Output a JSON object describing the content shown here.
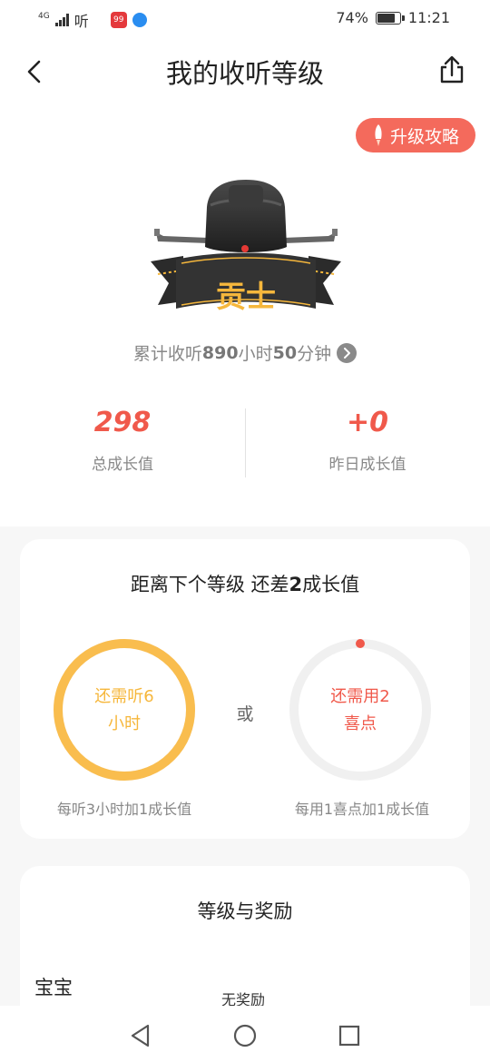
{
  "status_bar": {
    "network": "4G",
    "carrier_text": "听",
    "app_badge": "99",
    "battery_percent": "74%",
    "battery_level": 0.74,
    "time": "11:21"
  },
  "header": {
    "title": "我的收听等级"
  },
  "upgrade_button": {
    "label": "升级攻略"
  },
  "badge": {
    "level_name": "贡士"
  },
  "total_listen": {
    "prefix": "累计收听",
    "hours": "890",
    "hours_unit": "小时",
    "minutes": "50",
    "minutes_unit": "分钟"
  },
  "stats": {
    "total": {
      "value": "298",
      "label": "总成长值"
    },
    "yesterday": {
      "value": "+0",
      "label": "昨日成长值"
    }
  },
  "next_level": {
    "title_prefix": "距离下个等级 还差",
    "title_amount": "2",
    "title_suffix": "成长值",
    "listen_option": {
      "line1": "还需听6",
      "line2": "小时",
      "hint": "每听3小时加1成长值",
      "progress": 1.0
    },
    "or_label": "或",
    "coin_option": {
      "line1": "还需用2",
      "line2": "喜点",
      "hint": "每用1喜点加1成长值",
      "progress": 0.0
    }
  },
  "rewards": {
    "title": "等级与奖励",
    "first_level": {
      "name": "宝宝",
      "description": "无奖励"
    }
  },
  "colors": {
    "accent_red": "#f0594b",
    "accent_orange": "#f6b73c",
    "upgrade_bg": "#f46a5c"
  },
  "icons": {
    "back": "chevron-left-icon",
    "share": "share-icon",
    "rocket": "rocket-icon",
    "arrow": "chevron-right-icon"
  }
}
